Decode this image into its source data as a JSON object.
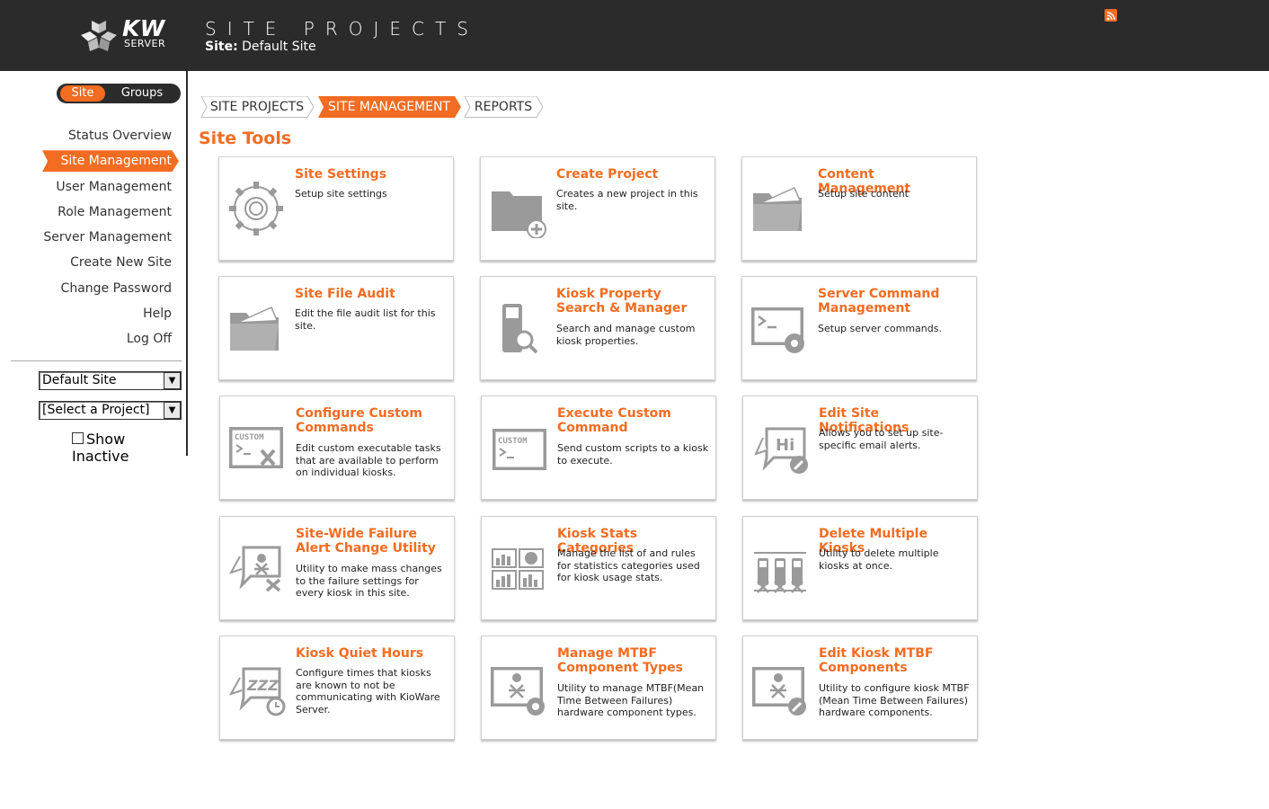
{
  "header": {
    "logo_main": "KW",
    "logo_sub": "SERVER",
    "title": "SITE PROJECTS",
    "site_label": "Site:",
    "site_name": "Default Site"
  },
  "sidebar": {
    "toggle": {
      "site": "Site",
      "groups": "Groups"
    },
    "items": [
      {
        "label": "Status Overview",
        "active": false
      },
      {
        "label": "Site Management",
        "active": true
      },
      {
        "label": "User Management",
        "active": false
      },
      {
        "label": "Role Management",
        "active": false
      },
      {
        "label": "Server Management",
        "active": false
      },
      {
        "label": "Create New Site",
        "active": false
      },
      {
        "label": "Change Password",
        "active": false
      },
      {
        "label": "Help",
        "active": false
      },
      {
        "label": "Log Off",
        "active": false
      }
    ],
    "site_select": "Default Site",
    "project_select": "[Select a Project]",
    "show_inactive": "Show Inactive"
  },
  "tabs": [
    {
      "label": "SITE PROJECTS",
      "active": false
    },
    {
      "label": "SITE MANAGEMENT",
      "active": true
    },
    {
      "label": "REPORTS",
      "active": false
    }
  ],
  "section_title": "Site Tools",
  "cards": [
    {
      "title": "Site Settings",
      "desc": "Setup site settings",
      "icon": "gear-icon"
    },
    {
      "title": "Create Project",
      "desc": "Creates a new project in this site.",
      "icon": "folder-add-icon"
    },
    {
      "title": "Content Management",
      "desc": "Setup site content",
      "icon": "folder-content-icon"
    },
    {
      "title": "Site File Audit",
      "desc": "Edit the file audit list for this site.",
      "icon": "folder-audit-icon"
    },
    {
      "title": "Kiosk Property Search & Manager",
      "desc": "Search and manage custom kiosk properties.",
      "icon": "kiosk-search-icon"
    },
    {
      "title": "Server Command Management",
      "desc": "Setup server commands.",
      "icon": "terminal-gear-icon"
    },
    {
      "title": "Configure Custom Commands",
      "desc": "Edit custom executable tasks that are available to perform on individual kiosks.",
      "icon": "custom-tools-icon"
    },
    {
      "title": "Execute Custom Command",
      "desc": "Send custom scripts to a kiosk to execute.",
      "icon": "custom-command-icon"
    },
    {
      "title": "Edit Site Notifications",
      "desc": "Allows you to set up site-specific email alerts.",
      "icon": "notification-edit-icon"
    },
    {
      "title": "Site-Wide Failure Alert Change Utility",
      "desc": "Utility to make mass changes to the failure settings for every kiosk in this site.",
      "icon": "failure-alert-icon"
    },
    {
      "title": "Kiosk Stats Categories",
      "desc": "Manage the list of and rules for statistics categories used for kiosk usage stats.",
      "icon": "stats-grid-icon"
    },
    {
      "title": "Delete Multiple Kiosks",
      "desc": "Utility to delete multiple kiosks at once.",
      "icon": "delete-kiosks-icon"
    },
    {
      "title": "Kiosk Quiet Hours",
      "desc": "Configure times that kiosks are known to not be communicating with KioWare Server.",
      "icon": "quiet-hours-icon"
    },
    {
      "title": "Manage MTBF Component Types",
      "desc": "Utility to manage MTBF(Mean Time Between Failures) hardware component types.",
      "icon": "mtbf-gear-icon"
    },
    {
      "title": "Edit Kiosk MTBF Components",
      "desc": "Utility to configure kiosk MTBF (Mean Time Between Failures) hardware components.",
      "icon": "mtbf-edit-icon"
    }
  ],
  "colors": {
    "accent": "#f26c21",
    "header_bg": "#2b2b2b",
    "icon_gray": "#9a9a9a"
  }
}
